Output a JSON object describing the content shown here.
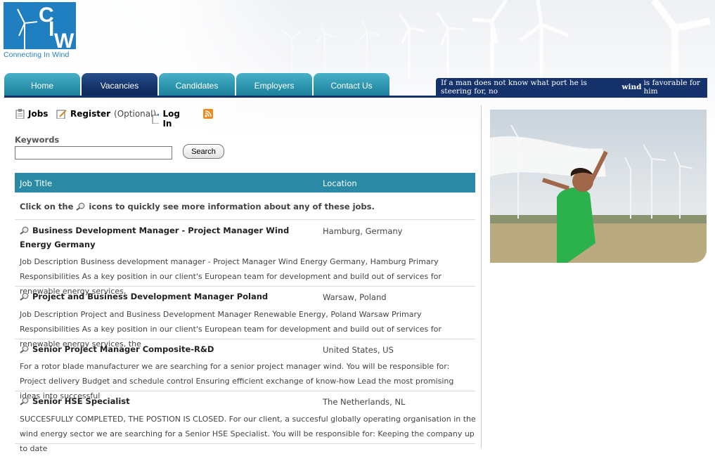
{
  "brand": {
    "logo_letters": "CIW",
    "tagline": "Connecting In Wind",
    "accent": "#1f7fc0",
    "nav_dark": "#15336a",
    "nav_teal": "#2b93ad"
  },
  "nav": {
    "tabs": [
      {
        "label": "Home",
        "active": false
      },
      {
        "label": "Vacancies",
        "active": true
      },
      {
        "label": "Candidates",
        "active": false
      },
      {
        "label": "Employers",
        "active": false
      },
      {
        "label": "Contact Us",
        "active": false
      }
    ],
    "quote_before": "If a man does not know what port he is steering for, no ",
    "quote_bold": "wind",
    "quote_after": " is favorable for him"
  },
  "toolbar": {
    "jobs_label": "Jobs",
    "register_label": "Register",
    "register_note": "(Optional)",
    "login_label": "Log In",
    "icons": [
      "clipboard-icon",
      "register-pencil-icon",
      "login-icon",
      "rss-icon"
    ]
  },
  "search": {
    "keywords_label": "Keywords",
    "value": "",
    "button_label": "Search"
  },
  "table": {
    "headers": {
      "title": "Job Title",
      "location": "Location"
    },
    "hint_before": "Click on the",
    "hint_after": "icons to quickly see more information about any of these jobs.",
    "jobs": [
      {
        "title": "Business Development Manager - Project Manager Wind Energy Germany",
        "location": "Hamburg, Germany",
        "description": "Job Description Business development manager - Project Manager Wind Energy Germany, Hamburg Primary Responsibilities As a key position in our client's European team for development and build out of services for renewable energy services,"
      },
      {
        "title": "Project and Business Development Manager Poland",
        "location": "Warsaw, Poland",
        "description": "Job Description Project and Business Development Manager Renewable Energy, Poland Warsaw Primary Responsibilities As a key position in our client's European team for development and build out of services for renewable energy services, the"
      },
      {
        "title": "Senior Project Manager Composite-R&D",
        "location": "United States, US",
        "description": "For a rotor blade manufacturer we are searching for a senior project manager wind. You will be responsible for: Project delivery Budget and schedule control Ensuring efficient exchange of know-how Lead the most promising ideas into successful"
      },
      {
        "title": "Senior HSE Specialist",
        "location": "The Netherlands, NL",
        "description": "SUCCESFULLY COMPLETED, THE POSTION IS CLOSED. For our client, a succesful globally operating organisation in the wind energy sector we are searching for a Senior HSE Specialist. You will be responsible for: Keeping the company up to date"
      }
    ]
  }
}
